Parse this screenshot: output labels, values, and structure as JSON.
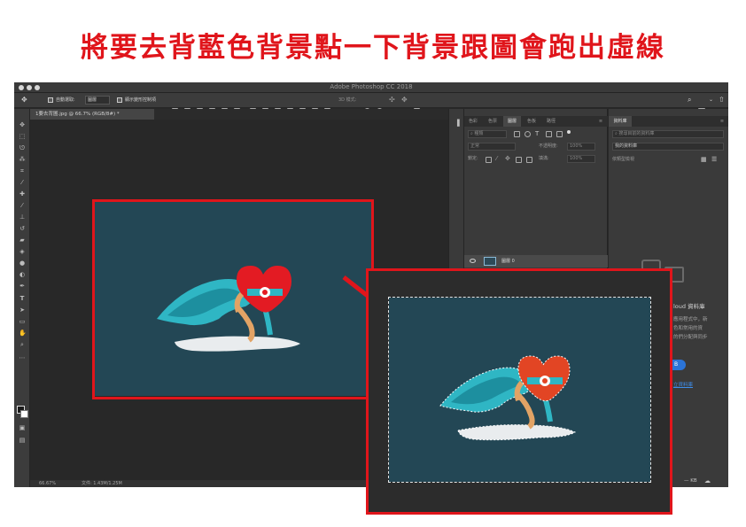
{
  "headline": "將要去背藍色背景點一下背景跟圖會跑出虛線",
  "app": {
    "title": "Adobe Photoshop CC 2018"
  },
  "options_bar": {
    "auto_select_label": "自動選取:",
    "auto_select_value": "圖層",
    "transform_controls_label": "顯示變形控制項",
    "mode_3d_label": "3D 模式:"
  },
  "document_tab": {
    "label": "1要去背圖.jpg @ 66.7% (RGB/8#) *"
  },
  "status_bar": {
    "zoom": "66.67%",
    "doc_info": "文件: 1.43M/1.25M"
  },
  "panels": {
    "tabs": [
      "色彩",
      "色票",
      "圖層",
      "色板",
      "路徑"
    ],
    "active_tab": "圖層",
    "filter_kind": "種類",
    "blend_mode": "正常",
    "opacity_label": "不透明度:",
    "opacity_value": "100%",
    "lock_label": "鎖定:",
    "fill_label": "填滿:",
    "fill_value": "100%",
    "layer_name": "圖層 0"
  },
  "libraries": {
    "tab": "資料庫",
    "search_placeholder": "搜尋目前的資料庫",
    "library_select": "我的資料庫",
    "view_by": "依類型檢視",
    "empty_title": "loud 資料庫",
    "empty_line1": "應用程式中，新",
    "empty_line2": "色和常用的資",
    "empty_line3": "的們分配與同步",
    "button_label": "B",
    "link_label": "立資料庫",
    "size_label": "— KB"
  },
  "colors": {
    "headline_red": "#e0151b",
    "artwork_background": "#234755",
    "cape_teal": "#2fb6c4",
    "heart_red_1": "#e31b23",
    "heart_red_2": "#e24524",
    "cloud": "#e9ecee"
  }
}
